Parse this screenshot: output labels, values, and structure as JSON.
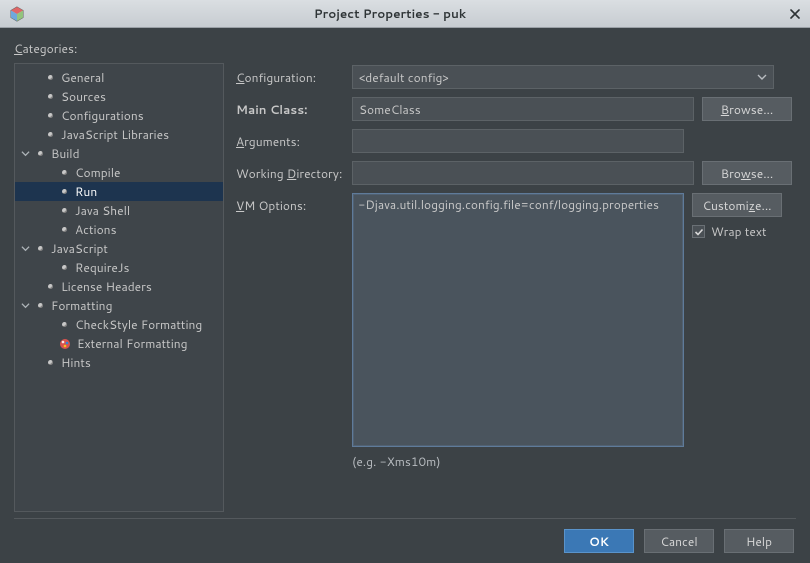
{
  "window": {
    "title": "Project Properties - puk"
  },
  "sidebar": {
    "heading": "Categories:",
    "items": {
      "general": "General",
      "sources": "Sources",
      "configurations": "Configurations",
      "jslibs": "JavaScript Libraries",
      "build": "Build",
      "compile": "Compile",
      "run": "Run",
      "javashell": "Java Shell",
      "actions": "Actions",
      "javascript": "JavaScript",
      "requirejs": "RequireJs",
      "license": "License Headers",
      "formatting": "Formatting",
      "checkstyle": "CheckStyle Formatting",
      "external_fmt": "External Formatting",
      "hints": "Hints"
    }
  },
  "form": {
    "labels": {
      "configuration": "Configuration:",
      "main_class": "Main Class:",
      "arguments": "Arguments:",
      "working_dir": "Working Directory:",
      "vm_options": "VM Options:"
    },
    "configuration": {
      "selected": "<default config>"
    },
    "main_class": {
      "value": "SomeClass"
    },
    "arguments": {
      "value": ""
    },
    "working_dir": {
      "value": ""
    },
    "vm_options": {
      "value": " -Djava.util.logging.config.file=conf/logging.properties"
    },
    "hint": "(e.g. -Xms10m)"
  },
  "buttons": {
    "browse": "Browse...",
    "customize": "Customize...",
    "ok": "OK",
    "cancel": "Cancel",
    "help": "Help"
  },
  "wrap_text": {
    "label": "Wrap text",
    "checked": true
  }
}
